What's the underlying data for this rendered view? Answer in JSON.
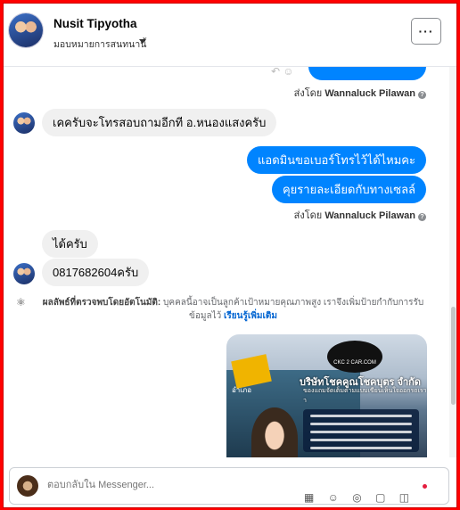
{
  "header": {
    "name": "Nusit Tipyotha",
    "assign_label": "มอบหมายการสนทนานี้",
    "more_label": "···"
  },
  "messages": {
    "partial_outgoing": "",
    "sent_by_prefix": "ส่งโดย",
    "sent_by_name_1": "Wannaluck Pilawan",
    "incoming_1": "เคครับจะโทรสอบถามอีกที อ.หนองแสงครับ",
    "outgoing_1": "แอดมินขอเบอร์โทรไว้ได้ไหมคะ",
    "outgoing_2": "คุยรายละเอียดกับทางเซลล์",
    "sent_by_name_2": "Wannaluck Pilawan",
    "incoming_2": "ได้ครับ",
    "incoming_3": "0817682604ครับ"
  },
  "ai_note": {
    "label": "ผลลัพธ์ที่ตรวจพบโดยอัตโนมัติ:",
    "text": "บุคคลนี้อาจเป็นลูกค้าเป้าหมายคุณภาพสูง เราจึงเพิ่มป้ายกำกับการรับข้อมูลไว้",
    "learn_more": "เรียนรู้เพิ่มเติม"
  },
  "ad": {
    "logo_text": "CKC 2 CAR.COM",
    "title": "บริษัทโชคคูณโชคบุตร จำกัด",
    "subtitle": "ของแถมจัดเต็มตามแบบเขียนเห็นใจออกรถเราา",
    "town": "อำเภอ"
  },
  "composer": {
    "placeholder": "ตอบกลับใน Messenger..."
  }
}
